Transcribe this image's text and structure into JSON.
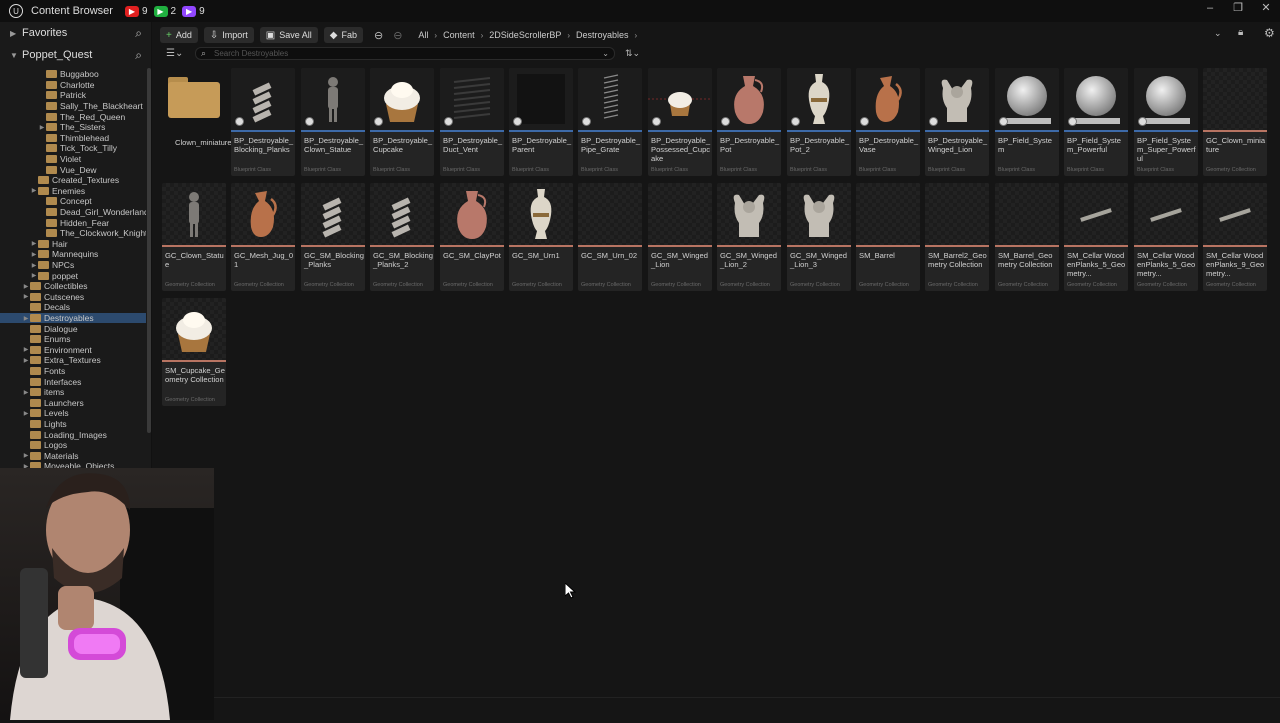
{
  "window": {
    "title": "Content Browser",
    "badges": [
      {
        "icon": "youtube-icon",
        "count": "9",
        "color": "#e02020"
      },
      {
        "icon": "xbox-icon",
        "count": "2",
        "color": "#20b040"
      },
      {
        "icon": "twitch-icon",
        "count": "9",
        "color": "#9146ff"
      }
    ]
  },
  "sidebar": {
    "favorites_label": "Favorites",
    "project_label": "Poppet_Quest",
    "tree": [
      {
        "label": "Buggaboo",
        "indent": 4,
        "tw": false
      },
      {
        "label": "Charlotte",
        "indent": 4,
        "tw": false
      },
      {
        "label": "Patrick",
        "indent": 4,
        "tw": false
      },
      {
        "label": "Sally_The_Blackheart",
        "indent": 4,
        "tw": false
      },
      {
        "label": "The_Red_Queen",
        "indent": 4,
        "tw": false
      },
      {
        "label": "The_Sisters",
        "indent": 4,
        "tw": true
      },
      {
        "label": "Thimblehead",
        "indent": 4,
        "tw": false
      },
      {
        "label": "Tick_Tock_Tilly",
        "indent": 4,
        "tw": false
      },
      {
        "label": "Violet",
        "indent": 4,
        "tw": false
      },
      {
        "label": "Vue_Dew",
        "indent": 4,
        "tw": false
      },
      {
        "label": "Created_Textures",
        "indent": 3,
        "tw": false
      },
      {
        "label": "Enemies",
        "indent": 3,
        "tw": true
      },
      {
        "label": "Concept",
        "indent": 4,
        "tw": false
      },
      {
        "label": "Dead_Girl_Wonderland",
        "indent": 4,
        "tw": false
      },
      {
        "label": "Hidden_Fear",
        "indent": 4,
        "tw": false
      },
      {
        "label": "The_Clockwork_Knight",
        "indent": 4,
        "tw": false
      },
      {
        "label": "Hair",
        "indent": 3,
        "tw": true
      },
      {
        "label": "Mannequins",
        "indent": 3,
        "tw": true
      },
      {
        "label": "NPCs",
        "indent": 3,
        "tw": true
      },
      {
        "label": "poppet",
        "indent": 3,
        "tw": true
      },
      {
        "label": "Collectibles",
        "indent": 2,
        "tw": true
      },
      {
        "label": "Cutscenes",
        "indent": 2,
        "tw": true
      },
      {
        "label": "Decals",
        "indent": 2,
        "tw": false
      },
      {
        "label": "Destroyables",
        "indent": 2,
        "tw": true,
        "selected": true
      },
      {
        "label": "Dialogue",
        "indent": 2,
        "tw": false
      },
      {
        "label": "Enums",
        "indent": 2,
        "tw": false
      },
      {
        "label": "Environment",
        "indent": 2,
        "tw": true
      },
      {
        "label": "Extra_Textures",
        "indent": 2,
        "tw": true
      },
      {
        "label": "Fonts",
        "indent": 2,
        "tw": false
      },
      {
        "label": "Interfaces",
        "indent": 2,
        "tw": false
      },
      {
        "label": "items",
        "indent": 2,
        "tw": true
      },
      {
        "label": "Launchers",
        "indent": 2,
        "tw": false
      },
      {
        "label": "Levels",
        "indent": 2,
        "tw": true
      },
      {
        "label": "Lights",
        "indent": 2,
        "tw": false
      },
      {
        "label": "Loading_Images",
        "indent": 2,
        "tw": false
      },
      {
        "label": "Logos",
        "indent": 2,
        "tw": false
      },
      {
        "label": "Materials",
        "indent": 2,
        "tw": true
      },
      {
        "label": "Moveable_Objects",
        "indent": 2,
        "tw": true
      }
    ]
  },
  "toolbar": {
    "add_label": "Add",
    "import_label": "Import",
    "save_all_label": "Save All",
    "fab_label": "Fab",
    "breadcrumbs": [
      "All",
      "Content",
      "2DSideScrollerBP",
      "Destroyables"
    ]
  },
  "search": {
    "placeholder": "Search Destroyables"
  },
  "assets": [
    {
      "name": "Clown_miniature_Clown_miniature",
      "type": "",
      "kind": "folder"
    },
    {
      "name": "BP_Destroyable_Blocking_Planks",
      "type": "Blueprint Class",
      "kind": "bp",
      "thumb": "planks"
    },
    {
      "name": "BP_Destroyable_Clown_Statue",
      "type": "Blueprint Class",
      "kind": "bp",
      "thumb": "statue"
    },
    {
      "name": "BP_Destroyable_Cupcake",
      "type": "Blueprint Class",
      "kind": "bp",
      "thumb": "cupcake"
    },
    {
      "name": "BP_Destroyable_Duct_Vent",
      "type": "Blueprint Class",
      "kind": "bp",
      "thumb": "vent"
    },
    {
      "name": "BP_Destroyable_Parent",
      "type": "Blueprint Class",
      "kind": "bp",
      "thumb": "cube"
    },
    {
      "name": "BP_Destroyable_Pipe_Grate",
      "type": "Blueprint Class",
      "kind": "bp",
      "thumb": "grate"
    },
    {
      "name": "BP_Destroyable_Possessed_Cupcake",
      "type": "Blueprint Class",
      "kind": "bp",
      "thumb": "cupcake-small"
    },
    {
      "name": "BP_Destroyable_Pot",
      "type": "Blueprint Class",
      "kind": "bp",
      "thumb": "pot"
    },
    {
      "name": "BP_Destroyable_Pot_2",
      "type": "Blueprint Class",
      "kind": "bp",
      "thumb": "urn"
    },
    {
      "name": "BP_Destroyable_Vase",
      "type": "Blueprint Class",
      "kind": "bp",
      "thumb": "jug"
    },
    {
      "name": "BP_Destroyable_Winged_Lion",
      "type": "Blueprint Class",
      "kind": "bp",
      "thumb": "lion"
    },
    {
      "name": "BP_Field_System",
      "type": "Blueprint Class",
      "kind": "bp",
      "thumb": "sphere"
    },
    {
      "name": "BP_Field_System_Powerful",
      "type": "Blueprint Class",
      "kind": "bp",
      "thumb": "sphere"
    },
    {
      "name": "BP_Field_System_Super_Powerful",
      "type": "Blueprint Class",
      "kind": "bp",
      "thumb": "sphere"
    },
    {
      "name": "GC_Clown_miniature",
      "type": "Geometry Collection",
      "kind": "gc",
      "thumb": "empty"
    },
    {
      "name": "GC_Clown_Statue",
      "type": "Geometry Collection",
      "kind": "gc",
      "thumb": "statue"
    },
    {
      "name": "GC_Mesh_Jug_01",
      "type": "Geometry Collection",
      "kind": "gc",
      "thumb": "jug"
    },
    {
      "name": "GC_SM_Blocking_Planks",
      "type": "Geometry Collection",
      "kind": "gc",
      "thumb": "planks"
    },
    {
      "name": "GC_SM_Blocking_Planks_2",
      "type": "Geometry Collection",
      "kind": "gc",
      "thumb": "planks"
    },
    {
      "name": "GC_SM_ClayPot",
      "type": "Geometry Collection",
      "kind": "gc",
      "thumb": "pot"
    },
    {
      "name": "GC_SM_Urn1",
      "type": "Geometry Collection",
      "kind": "gc",
      "thumb": "urn"
    },
    {
      "name": "GC_SM_Urn_02",
      "type": "Geometry Collection",
      "kind": "gc",
      "thumb": "empty"
    },
    {
      "name": "GC_SM_Winged_Lion",
      "type": "Geometry Collection",
      "kind": "gc",
      "thumb": "empty"
    },
    {
      "name": "GC_SM_Winged_Lion_2",
      "type": "Geometry Collection",
      "kind": "gc",
      "thumb": "lion"
    },
    {
      "name": "GC_SM_Winged_Lion_3",
      "type": "Geometry Collection",
      "kind": "gc",
      "thumb": "lion"
    },
    {
      "name": "SM_Barrel",
      "type": "Geometry Collection",
      "kind": "gc",
      "thumb": "empty"
    },
    {
      "name": "SM_Barrel2_Geometry Collection",
      "type": "Geometry Collection",
      "kind": "gc",
      "thumb": "empty"
    },
    {
      "name": "SM_Barrel_Geometry Collection",
      "type": "Geometry Collection",
      "kind": "gc",
      "thumb": "empty"
    },
    {
      "name": "SM_Cellar WoodenPlanks_5_Geometry...",
      "type": "Geometry Collection",
      "kind": "gc",
      "thumb": "plank"
    },
    {
      "name": "SM_Cellar WoodenPlanks_5_Geometry...",
      "type": "Geometry Collection",
      "kind": "gc",
      "thumb": "plank"
    },
    {
      "name": "SM_Cellar WoodenPlanks_9_Geometry...",
      "type": "Geometry Collection",
      "kind": "gc",
      "thumb": "plank"
    },
    {
      "name": "SM_Cupcake_Geometry Collection",
      "type": "Geometry Collection",
      "kind": "gc",
      "thumb": "cupcake"
    }
  ]
}
